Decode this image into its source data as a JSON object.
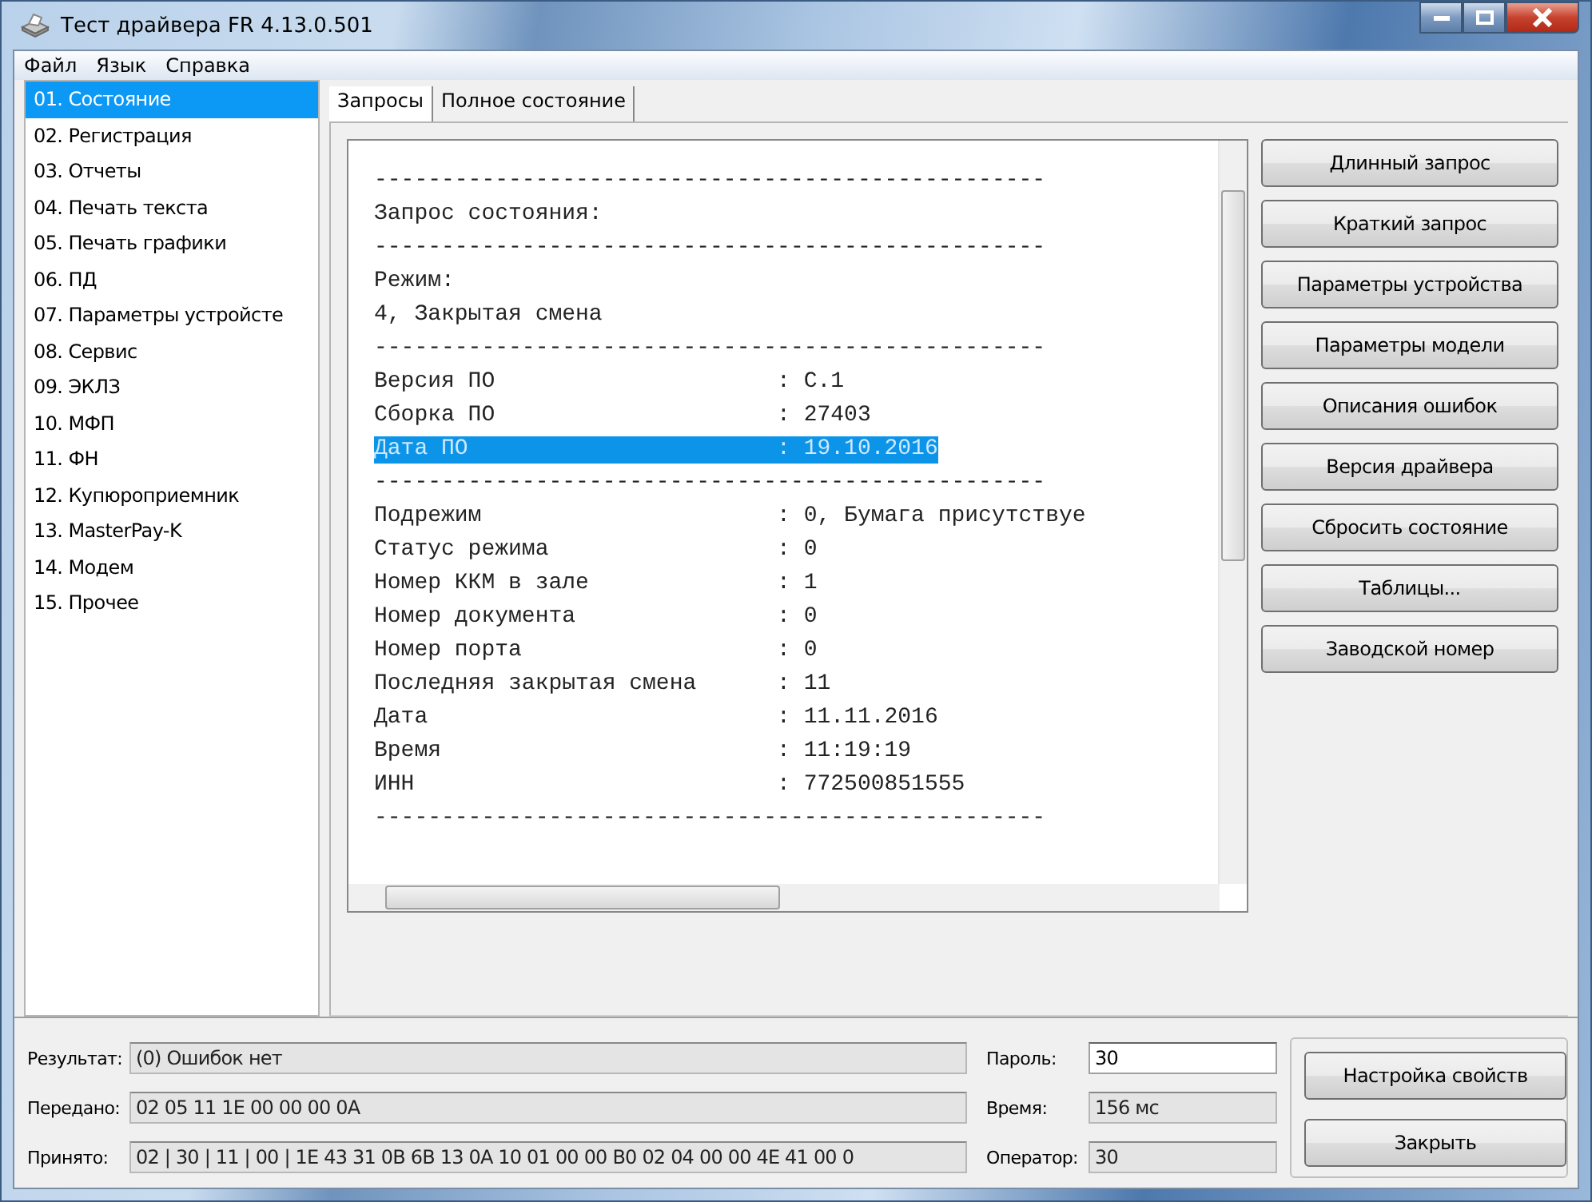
{
  "window": {
    "title": "Тест драйвера FR 4.13.0.501"
  },
  "menu": [
    "Файл",
    "Язык",
    "Справка"
  ],
  "sidebar": {
    "items": [
      {
        "label": "01. Состояние",
        "selected": true
      },
      {
        "label": "02. Регистрация",
        "selected": false
      },
      {
        "label": "03. Отчеты",
        "selected": false
      },
      {
        "label": "04. Печать текста",
        "selected": false
      },
      {
        "label": "05. Печать графики",
        "selected": false
      },
      {
        "label": "06. ПД",
        "selected": false
      },
      {
        "label": "07. Параметры устройсте",
        "selected": false
      },
      {
        "label": "08. Сервис",
        "selected": false
      },
      {
        "label": "09. ЭКЛЗ",
        "selected": false
      },
      {
        "label": "10. МФП",
        "selected": false
      },
      {
        "label": "11. ФН",
        "selected": false
      },
      {
        "label": "12. Купюроприемник",
        "selected": false
      },
      {
        "label": "13. MasterPay-K",
        "selected": false
      },
      {
        "label": "14. Модем",
        "selected": false
      },
      {
        "label": "15. Прочее",
        "selected": false
      }
    ]
  },
  "tabs": [
    {
      "label": "Запросы",
      "selected": true
    },
    {
      "label": "Полное состояние",
      "selected": false
    }
  ],
  "output": {
    "lines": [
      {
        "text": "--------------------------------------------------",
        "selected": false
      },
      {
        "text": "Запрос состояния:",
        "selected": false
      },
      {
        "text": "--------------------------------------------------",
        "selected": false
      },
      {
        "text": "Режим:",
        "selected": false
      },
      {
        "text": "4, Закрытая смена",
        "selected": false
      },
      {
        "text": "--------------------------------------------------",
        "selected": false
      },
      {
        "text": "Версия ПО                     : C.1",
        "selected": false
      },
      {
        "text": "Сборка ПО                     : 27403",
        "selected": false
      },
      {
        "text": "Дата ПО                       : 19.10.2016",
        "selected": true
      },
      {
        "text": "--------------------------------------------------",
        "selected": false
      },
      {
        "text": "Подрежим                      : 0, Бумага присутствуе",
        "selected": false
      },
      {
        "text": "Статус режима                 : 0",
        "selected": false
      },
      {
        "text": "Номер ККМ в зале              : 1",
        "selected": false
      },
      {
        "text": "Номер документа               : 0",
        "selected": false
      },
      {
        "text": "Номер порта                   : 0",
        "selected": false
      },
      {
        "text": "Последняя закрытая смена      : 11",
        "selected": false
      },
      {
        "text": "Дата                          : 11.11.2016",
        "selected": false
      },
      {
        "text": "Время                         : 11:19:19",
        "selected": false
      },
      {
        "text": "ИНН                           : 772500851555",
        "selected": false
      },
      {
        "text": "--------------------------------------------------",
        "selected": false
      }
    ]
  },
  "buttons": [
    "Длинный запрос",
    "Краткий запрос",
    "Параметры устройства",
    "Параметры модели",
    "Описания ошибок",
    "Версия драйвера",
    "Сбросить состояние",
    "Таблицы...",
    "Заводской номер"
  ],
  "status": [
    {
      "label": "Результат:",
      "value": "(0) Ошибок нет"
    },
    {
      "label": "Передано:",
      "value": "02 05 11 1E 00 00 00 0A"
    },
    {
      "label": "Принято:",
      "value": "02 | 30 | 11 | 00 | 1E 43 31 0B 6B 13 0A 10 01 00 00 B0 02 04 00 00 4E 41 00 0"
    }
  ],
  "params": [
    {
      "label": "Пароль:",
      "value": "30",
      "read_only": false
    },
    {
      "label": "Время:",
      "value": "156 мс",
      "read_only": true
    },
    {
      "label": "Оператор:",
      "value": "30",
      "read_only": true
    }
  ],
  "actions": [
    "Настройка свойств",
    "Закрыть"
  ]
}
